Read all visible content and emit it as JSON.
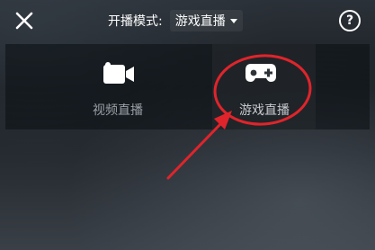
{
  "header": {
    "mode_label": "开播模式:",
    "mode_value": "游戏直播",
    "help_symbol": "?"
  },
  "options": [
    {
      "label": "视频直播",
      "icon": "video-camera-icon"
    },
    {
      "label": "游戏直播",
      "icon": "gamepad-icon"
    }
  ],
  "colors": {
    "annotation": "#e0242b",
    "text": "#ffffff",
    "muted_text": "#9aa0a6"
  }
}
